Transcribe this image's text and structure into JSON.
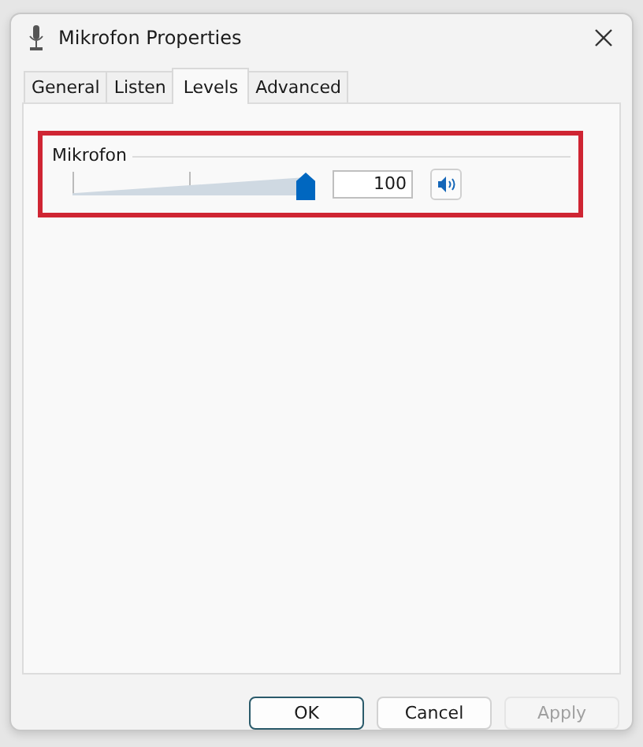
{
  "window": {
    "title": "Mikrofon Properties"
  },
  "tabs": [
    {
      "label": "General",
      "selected": false
    },
    {
      "label": "Listen",
      "selected": false
    },
    {
      "label": "Levels",
      "selected": true
    },
    {
      "label": "Advanced",
      "selected": false
    }
  ],
  "levels": [
    {
      "name": "Mikrofon",
      "level": 1.0,
      "value": "100",
      "muted": false,
      "highlighted": true
    }
  ],
  "buttons": [
    {
      "label": "OK",
      "default": true,
      "disabled": false
    },
    {
      "label": "Cancel",
      "default": false,
      "disabled": false
    },
    {
      "label": "Apply",
      "default": false,
      "disabled": true
    }
  ]
}
